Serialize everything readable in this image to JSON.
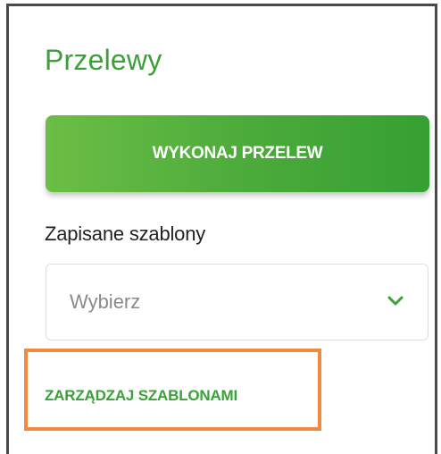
{
  "section": {
    "title": "Przelewy"
  },
  "primary_action": {
    "label": "WYKONAJ PRZELEW"
  },
  "templates": {
    "label": "Zapisane szablony",
    "select_value": "Wybierz",
    "chevron_icon": "chevron-down-icon"
  },
  "manage_link": {
    "label": "ZARZĄDZAJ SZABLONAMI"
  },
  "colors": {
    "accent_green": "#3aa037",
    "button_gradient_start": "#6cbe45",
    "button_gradient_end": "#36a033",
    "highlight_orange": "#f08a3e"
  }
}
